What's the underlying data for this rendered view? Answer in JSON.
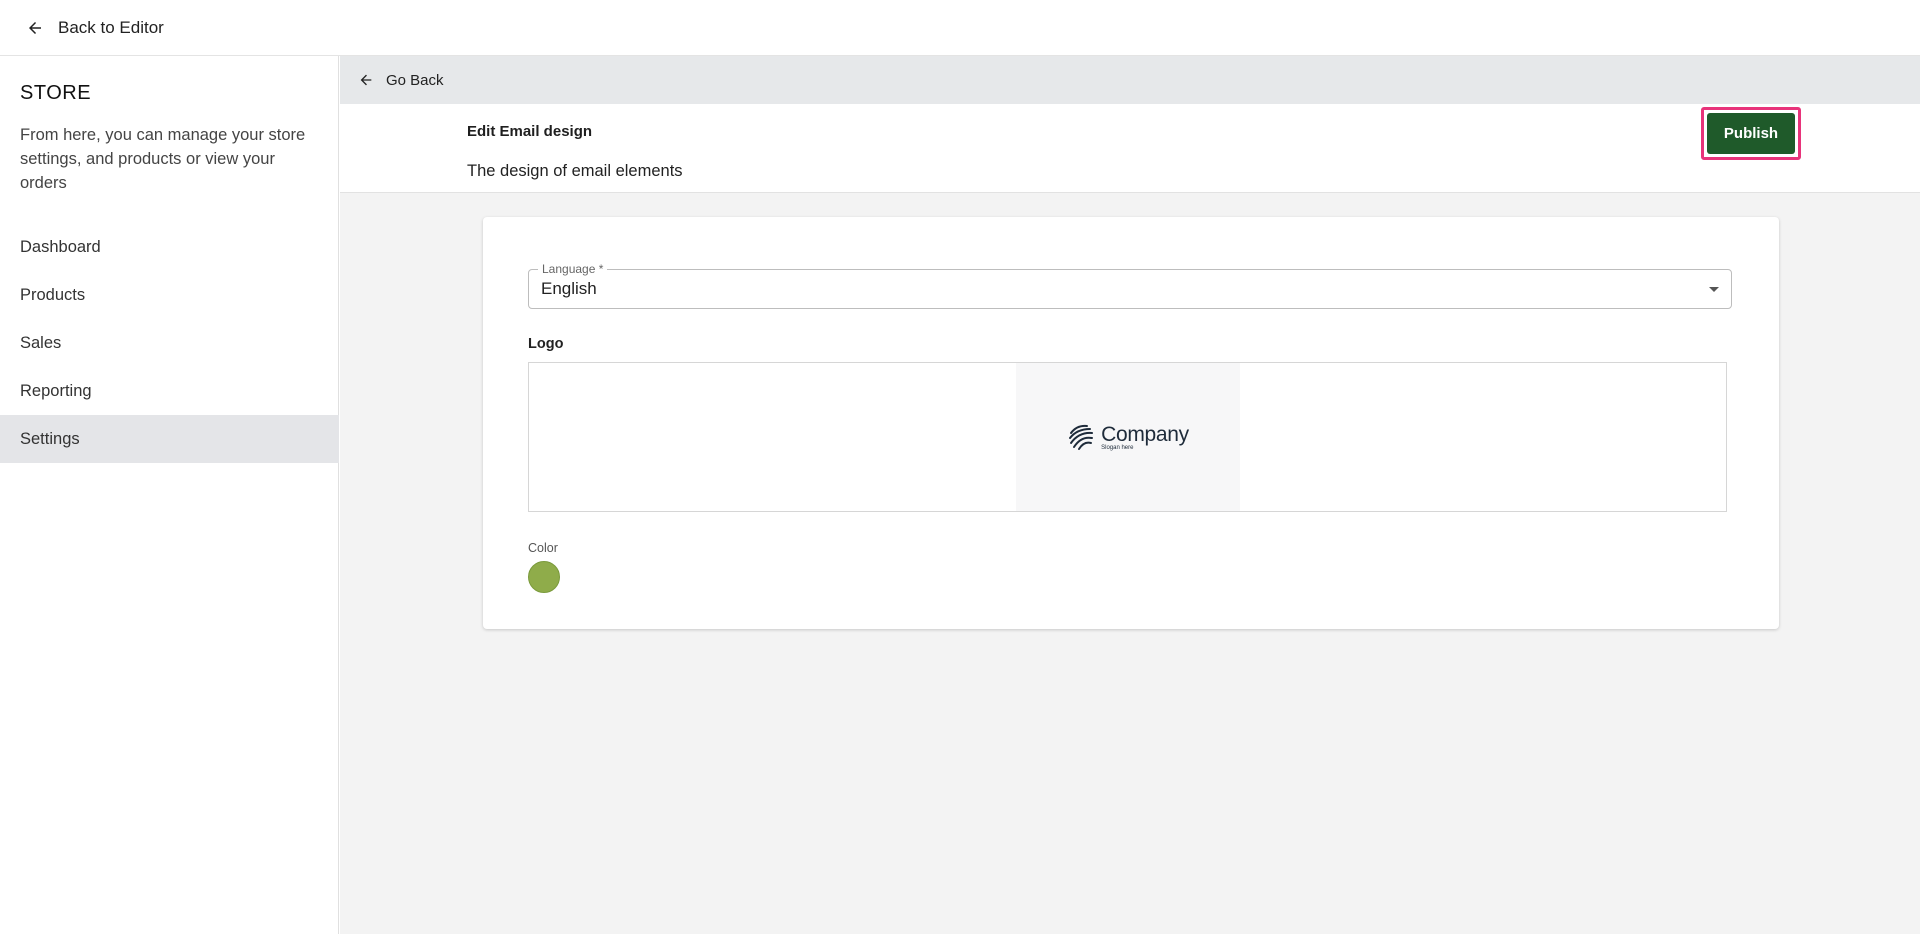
{
  "topbar": {
    "back_label": "Back to Editor",
    "back_icon": "arrow-left-icon"
  },
  "sidebar": {
    "title": "STORE",
    "description": "From here, you can manage your store settings, and products or view your orders",
    "items": [
      {
        "label": "Dashboard",
        "active": false
      },
      {
        "label": "Products",
        "active": false
      },
      {
        "label": "Sales",
        "active": false
      },
      {
        "label": "Reporting",
        "active": false
      },
      {
        "label": "Settings",
        "active": true
      }
    ]
  },
  "main": {
    "go_back_label": "Go Back",
    "header": {
      "title": "Edit Email design",
      "subtitle": "The design of email elements",
      "publish_label": "Publish"
    },
    "form": {
      "language": {
        "label": "Language *",
        "value": "English"
      },
      "logo": {
        "label": "Logo",
        "company_name": "Company",
        "slogan": "Slogan here"
      },
      "color": {
        "label": "Color",
        "value": "#8fac4a"
      }
    }
  },
  "colors": {
    "accent": "#1f5a2a",
    "highlight": "#e8337a",
    "sidebar_active": "#e4e5e8"
  }
}
